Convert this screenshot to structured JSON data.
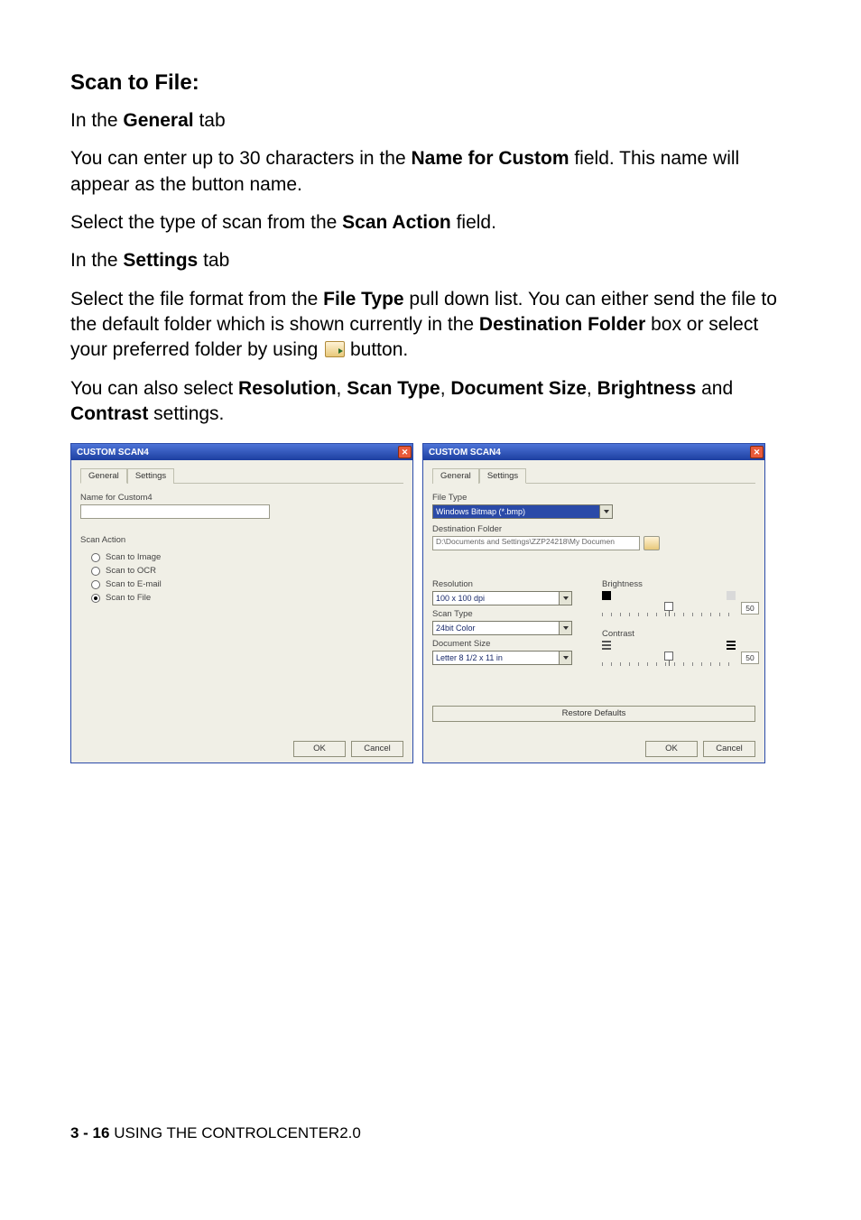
{
  "heading": "Scan to File:",
  "para1a": "In the ",
  "para1b": "General",
  "para1c": " tab",
  "para2a": "You can enter up to 30 characters in the ",
  "para2b": "Name for Custom",
  "para2c": " field. This name will appear as the button name.",
  "para3a": "Select the type of scan from the ",
  "para3b": "Scan Action",
  "para3c": " field.",
  "para4a": "In the ",
  "para4b": "Settings",
  "para4c": " tab",
  "para5a": "Select the file format from the ",
  "para5b": "File Type",
  "para5c": " pull down list. You can either send the file to the default folder which is shown currently in the ",
  "para5d": "Destination Folder",
  "para5e": " box or select your preferred folder by using ",
  "para5f": " button.",
  "para6a": "You can also select ",
  "para6b": "Resolution",
  "para6c": ", ",
  "para6d": "Scan Type",
  "para6e": ", ",
  "para6f": "Document Size",
  "para6g": ", ",
  "para6h": "Brightness",
  "para6i": " and ",
  "para6j": "Contrast",
  "para6k": " settings.",
  "dialog_title": "CUSTOM SCAN4",
  "tabs": {
    "general": "General",
    "settings": "Settings"
  },
  "general_tab": {
    "name_label": "Name for Custom4",
    "name_value": "",
    "scan_action_label": "Scan Action",
    "radios": {
      "image": "Scan to Image",
      "ocr": "Scan to OCR",
      "email": "Scan to E-mail",
      "file": "Scan to File"
    },
    "selected": "file"
  },
  "settings_tab": {
    "file_type_label": "File Type",
    "file_type_value": "Windows Bitmap (*.bmp)",
    "dest_label": "Destination Folder",
    "dest_value": "D:\\Documents and Settings\\ZZP24218\\My Documen",
    "resolution_label": "Resolution",
    "resolution_value": "100 x 100 dpi",
    "scantype_label": "Scan Type",
    "scantype_value": "24bit Color",
    "docsize_label": "Document Size",
    "docsize_value": "Letter 8 1/2 x 11 in",
    "brightness_label": "Brightness",
    "brightness_value": "50",
    "contrast_label": "Contrast",
    "contrast_value": "50",
    "restore_label": "Restore Defaults"
  },
  "buttons": {
    "ok": "OK",
    "cancel": "Cancel"
  },
  "footer": {
    "page": "3 - 16",
    "sep": "   ",
    "chapter": "USING THE CONTROLCENTER2.0"
  }
}
